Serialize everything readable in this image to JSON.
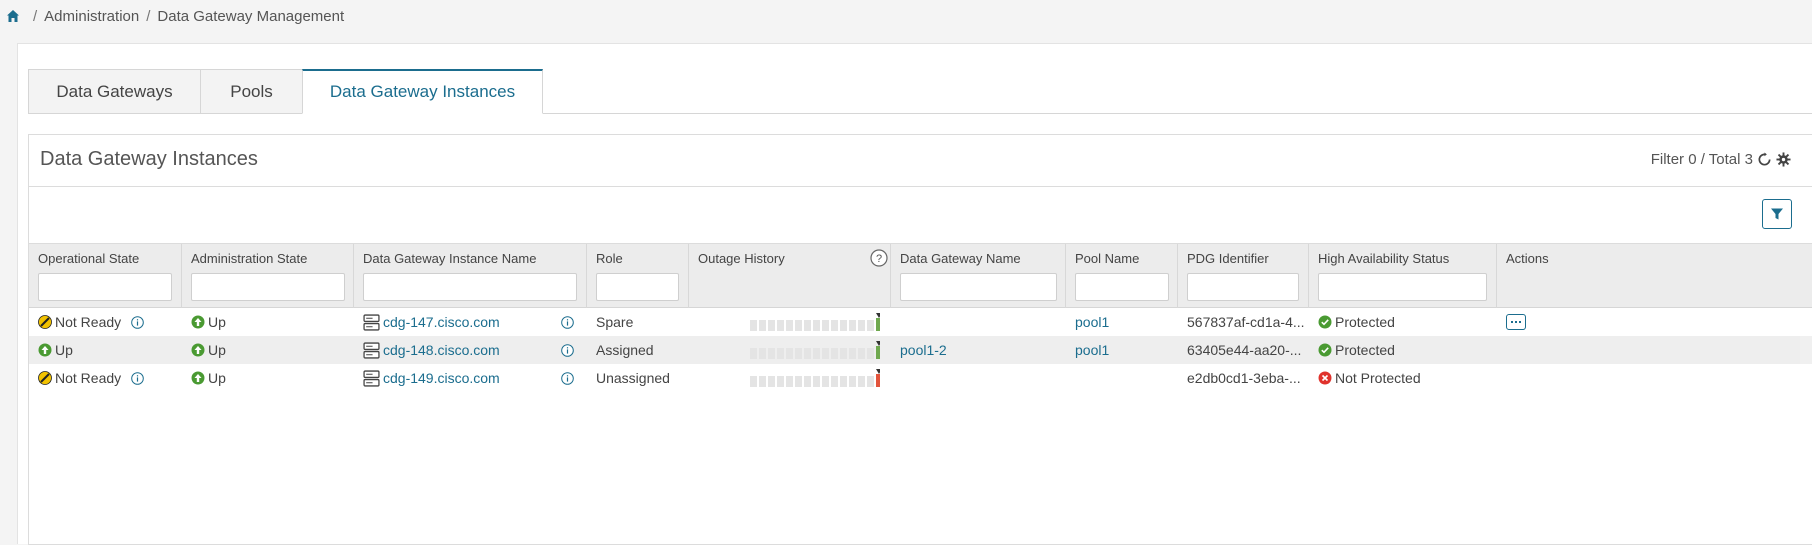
{
  "breadcrumb": {
    "items": [
      "Administration",
      "Data Gateway Management"
    ],
    "separator": "/"
  },
  "tabs": [
    {
      "label": "Data Gateways",
      "active": false
    },
    {
      "label": "Pools",
      "active": false
    },
    {
      "label": "Data Gateway Instances",
      "active": true
    }
  ],
  "card": {
    "title": "Data Gateway Instances",
    "filter_total": "Filter 0 / Total 3"
  },
  "columns": [
    "Operational State",
    "Administration State",
    "Data Gateway Instance Name",
    "Role",
    "Outage History",
    "Data Gateway Name",
    "Pool Name",
    "PDG Identifier",
    "High Availability Status",
    "Actions"
  ],
  "rows": [
    {
      "op_state": "Not Ready",
      "op_icon": "warning-icon",
      "admin_state": "Up",
      "instance_name": "cdg-147.cisco.com",
      "role": "Spare",
      "outage_last_color": "#6fa84f",
      "gateway_name": "",
      "pool_name": "pool1",
      "pdg_identifier": "567837af-cd1a-4...",
      "ha_status": "Protected",
      "ha_icon": "check-circle-icon"
    },
    {
      "op_state": "Up",
      "op_icon": "arrow-up-icon",
      "admin_state": "Up",
      "instance_name": "cdg-148.cisco.com",
      "role": "Assigned",
      "outage_last_color": "#6fa84f",
      "gateway_name": "pool1-2",
      "pool_name": "pool1",
      "pdg_identifier": "63405e44-aa20-...",
      "ha_status": "Protected",
      "ha_icon": "check-circle-icon"
    },
    {
      "op_state": "Not Ready",
      "op_icon": "warning-icon",
      "admin_state": "Up",
      "instance_name": "cdg-149.cisco.com",
      "role": "Unassigned",
      "outage_last_color": "#e2543c",
      "gateway_name": "",
      "pool_name": "",
      "pdg_identifier": "e2db0cd1-3eba-...",
      "ha_status": "Not Protected",
      "ha_icon": "x-circle-icon"
    }
  ],
  "colors": {
    "accent": "#1b6d8e",
    "up_green": "#4a9a32",
    "warning_yellow": "#f2c200",
    "error_red": "#e0322c"
  }
}
